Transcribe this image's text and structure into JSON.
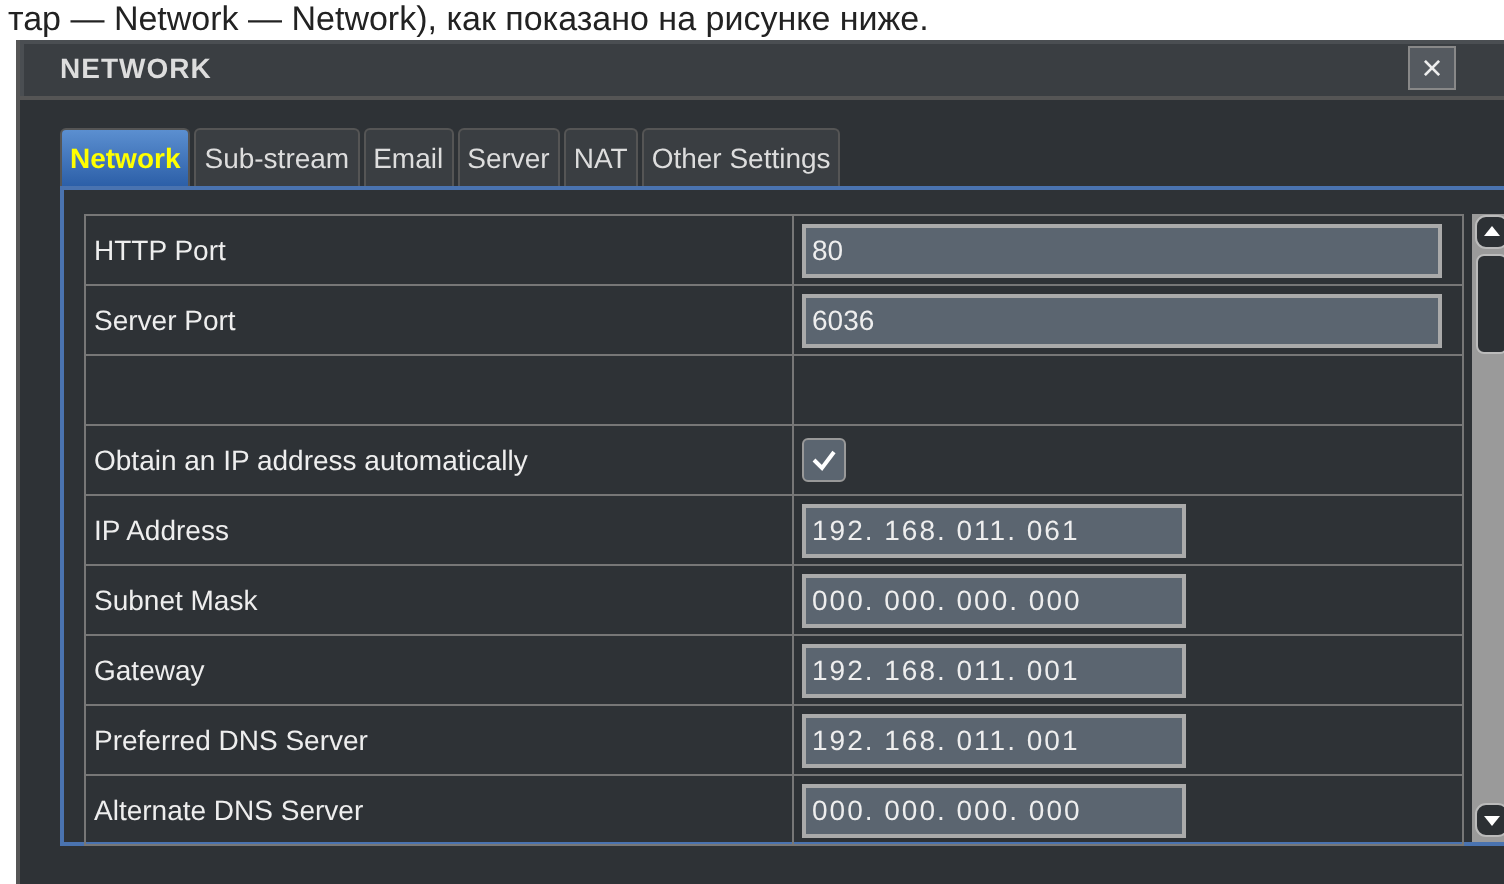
{
  "caption": "тар — Network — Network), как показано на рисунке ниже.",
  "window": {
    "title": "NETWORK",
    "close": "×"
  },
  "tabs": [
    {
      "label": "Network",
      "selected": true
    },
    {
      "label": "Sub-stream",
      "selected": false
    },
    {
      "label": "Email",
      "selected": false
    },
    {
      "label": "Server",
      "selected": false
    },
    {
      "label": "NAT",
      "selected": false
    },
    {
      "label": "Other Settings",
      "selected": false
    }
  ],
  "rows": [
    {
      "kind": "text",
      "label": "HTTP Port",
      "value": "80"
    },
    {
      "kind": "text",
      "label": "Server Port",
      "value": "6036"
    },
    {
      "kind": "blank"
    },
    {
      "kind": "checkbox",
      "label": "Obtain an IP address automatically",
      "checked": true
    },
    {
      "kind": "ip",
      "label": "IP Address",
      "value": "192. 168. 011. 061"
    },
    {
      "kind": "ip",
      "label": "Subnet Mask",
      "value": "000. 000. 000. 000"
    },
    {
      "kind": "ip",
      "label": "Gateway",
      "value": "192. 168. 011. 001"
    },
    {
      "kind": "ip",
      "label": "Preferred DNS Server",
      "value": "192. 168. 011. 001"
    },
    {
      "kind": "ip",
      "label": "Alternate DNS Server",
      "value": "000. 000. 000. 000"
    }
  ]
}
